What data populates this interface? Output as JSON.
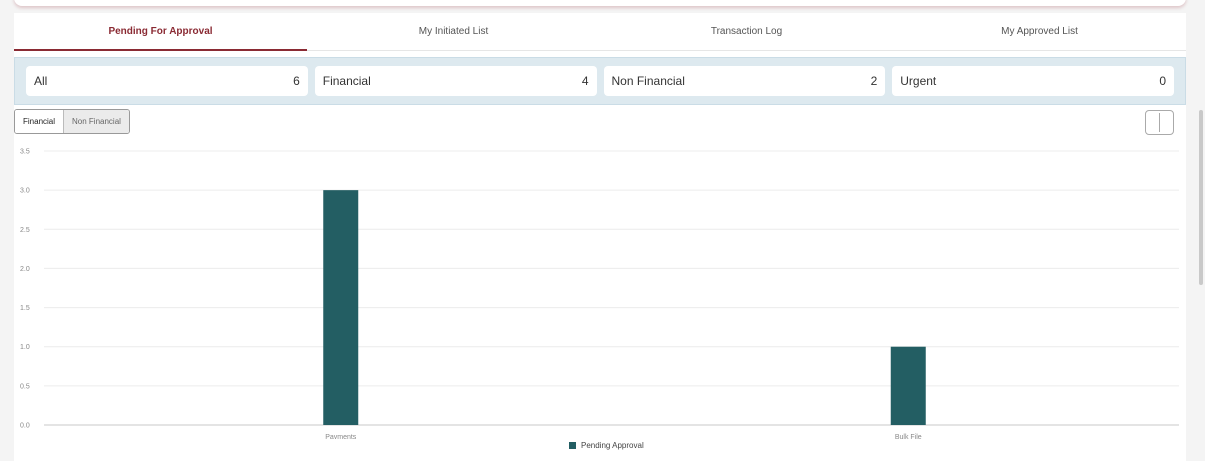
{
  "tabs": [
    {
      "label": "Pending For Approval",
      "active": true
    },
    {
      "label": "My Initiated List",
      "active": false
    },
    {
      "label": "Transaction Log",
      "active": false
    },
    {
      "label": "My Approved List",
      "active": false
    }
  ],
  "summary": [
    {
      "label": "All",
      "count": "6"
    },
    {
      "label": "Financial",
      "count": "4"
    },
    {
      "label": "Non Financial",
      "count": "2"
    },
    {
      "label": "Urgent",
      "count": "0"
    }
  ],
  "filter": {
    "financial_label": "Financial",
    "non_financial_label": "Non Financial",
    "selected": "Financial"
  },
  "colors": {
    "accent": "#8a2a33",
    "bar": "#235e63",
    "summary_bg": "#dde9ef"
  },
  "chart_data": {
    "type": "bar",
    "categories": [
      "Payments",
      "Bulk File"
    ],
    "series": [
      {
        "name": "Pending Approval",
        "values": [
          3,
          1
        ]
      }
    ],
    "yticks": [
      "0.0",
      "0.5",
      "1.0",
      "1.5",
      "2.0",
      "2.5",
      "3.0",
      "3.5"
    ],
    "ylim": [
      0,
      3.5
    ],
    "grid": true,
    "legend_position": "bottom-center"
  }
}
